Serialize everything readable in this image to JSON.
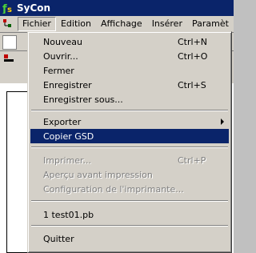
{
  "window": {
    "title": "SyCon",
    "app_icon": "sycon-logo-icon"
  },
  "menubar": {
    "items": [
      {
        "label": "Fichier"
      },
      {
        "label": "Edition"
      },
      {
        "label": "Affichage"
      },
      {
        "label": "Insérer"
      },
      {
        "label": "Paramèt"
      }
    ]
  },
  "menu": {
    "items": [
      {
        "label": "Nouveau",
        "shortcut": "Ctrl+N"
      },
      {
        "label": "Ouvrir...",
        "shortcut": "Ctrl+O"
      },
      {
        "label": "Fermer"
      },
      {
        "label": "Enregistrer",
        "shortcut": "Ctrl+S"
      },
      {
        "label": "Enregistrer sous..."
      },
      {
        "label": "Exporter"
      },
      {
        "label": "Copier GSD"
      },
      {
        "label": "Imprimer...",
        "shortcut": "Ctrl+P"
      },
      {
        "label": "Aperçu avant impression"
      },
      {
        "label": "Configuration de l'imprimante..."
      },
      {
        "label": "1 test01.pb"
      },
      {
        "label": "Quitter"
      }
    ]
  },
  "colors": {
    "titlebar": "#0a246a",
    "menu_bg": "#d4d0c8",
    "highlight": "#0a246a",
    "disabled_text": "#808080"
  }
}
